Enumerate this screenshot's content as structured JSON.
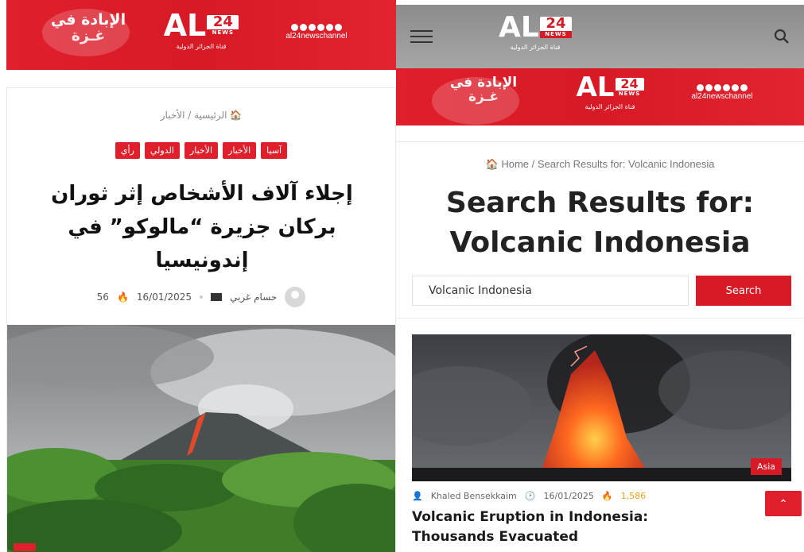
{
  "left": {
    "banner": {
      "gaza_line1": "الإبادة في",
      "gaza_line2": "غـزة",
      "logo_al": "AL",
      "logo_num": "24",
      "logo_news": "NEWS",
      "logo_sub": "قناة الجزائر الدولية",
      "social_handle": "al24newschannel"
    },
    "breadcrumb": "الرئيسية / الأخبار",
    "categories": [
      "آسيا",
      "الأخبار",
      "الأخبار",
      "الدولي",
      "رأي"
    ],
    "title": "إجلاء آلاف الأشخاص إثر ثوران بركان جزيرة “مالوكو” في إندونيسيا",
    "author": "حسام غربي",
    "date": "16/01/2025",
    "views": "56"
  },
  "right": {
    "topbar": {
      "logo_al": "AL",
      "logo_num": "24",
      "logo_news": "NEWS",
      "logo_sub": "قناة الجزائر الدولية"
    },
    "banner": {
      "gaza_line1": "الإبادة في",
      "gaza_line2": "غـزة",
      "logo_al": "AL",
      "logo_num": "24",
      "logo_news": "NEWS",
      "logo_sub": "قناة الجزائر الدولية",
      "social_handle": "al24newschannel"
    },
    "breadcrumb": "Home / Search Results for: Volcanic Indonesia",
    "search_title_line1": "Search Results for:",
    "search_title_line2": "Volcanic Indonesia",
    "search_value": "Volcanic Indonesia",
    "search_button": "Search",
    "result": {
      "tag": "Asia",
      "author": "Khaled Bensekkaim",
      "date": "16/01/2025",
      "views": "1,586",
      "title": "Volcanic Eruption in Indonesia: Thousands Evacuated"
    }
  },
  "colors": {
    "brand_red": "#d71a26",
    "accent_orange": "#f0a020"
  }
}
